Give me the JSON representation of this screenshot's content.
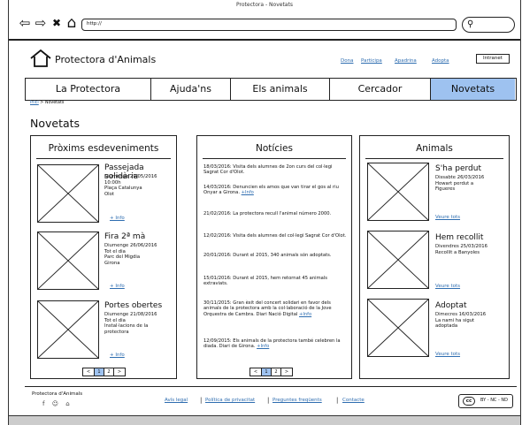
{
  "window": {
    "title": "Protectora - Novetats"
  },
  "browser": {
    "back_glyph": "⇦",
    "forward_glyph": "⇨",
    "close_glyph": "✖",
    "home_glyph": "⌂",
    "url": "http://",
    "search_glyph": "⚲"
  },
  "site": {
    "name": "Protectora d'Animals",
    "top_links": [
      "Dona",
      "Participa",
      "Apadrina",
      "Adopta"
    ],
    "intranet_label": "Intranet"
  },
  "nav": {
    "items": [
      "La Protectora",
      "Ajuda'ns",
      "Els animals",
      "Cercador",
      "Novetats"
    ],
    "active_index": 4,
    "active_color": "#9ec2f0"
  },
  "breadcrumb": {
    "home": "Inici",
    "separator": ">",
    "current": "Novetats"
  },
  "page": {
    "title": "Novetats"
  },
  "events": {
    "title": "Pròxims esdeveniments",
    "items": [
      {
        "title": "Passejada solidària",
        "details": "Diumenge 29/05/2016\n10:00h\nPlaça Catalunya\nOlot",
        "more": "+ Info"
      },
      {
        "title": "Fira 2ª mà",
        "details": "Diumenge 26/06/2016\nTot el dia\nParc del Migdia\nGirona",
        "more": "+ Info"
      },
      {
        "title": "Portes obertes",
        "details": "Diumenge 21/08/2016\nTot el dia\nInstal·lacions de la\nprotectora",
        "more": "+ Info"
      }
    ],
    "pager": [
      "<",
      "1",
      "2",
      ">"
    ]
  },
  "news": {
    "title": "Notícies",
    "items": [
      {
        "text": "18/03/2016: Visita dels alumnes de 2on curs del col·legi Sagrat Cor d'Olot.",
        "link": ""
      },
      {
        "text": "14/03/2016: Denuncien els amos que van tirar el gos al riu Onyar a Girona.",
        "link": "+Info"
      },
      {
        "text": "21/02/2016: La protectora recull l'animal número 2000.",
        "link": ""
      },
      {
        "text": "12/02/2016: Visita dels alumnes del col·legi Sagrat Cor d'Olot.",
        "link": ""
      },
      {
        "text": "20/01/2016: Durant el 2015, 340 animals són adoptats.",
        "link": ""
      },
      {
        "text": "15/01/2016: Durant el 2015, hem retornat 45 animals extraviats.",
        "link": ""
      },
      {
        "text": "30/11/2015: Gran èxit del concert solidari en favor dels animals de la protectora amb la col·laboració de la Jove Orquestra de Cambra. Diari Nació Digital",
        "link": "+Info"
      },
      {
        "text": "12/09/2015: Els animals de la protectora també celebren la diada. Diari de Girona.",
        "link": "+Info"
      }
    ],
    "pager": [
      "<",
      "1",
      "2",
      ">"
    ]
  },
  "animals": {
    "title": "Animals",
    "items": [
      {
        "title": "S'ha perdut",
        "details": "Dissabte 26/03/2016\nHowart perdut a\nFigueres",
        "more": "Veure tots"
      },
      {
        "title": "Hem recollit",
        "details": "Divendres 25/03/2016\nRecollit a Banyoles",
        "more": "Veure tots"
      },
      {
        "title": "Adoptat",
        "details": "Dimecres 16/03/2016\nLa nami ha sigut\nadoptada",
        "more": "Veure tots"
      }
    ]
  },
  "footer": {
    "name": "Protectora d'Animals",
    "social_glyphs": "f ☺ ⌂",
    "links": [
      "Avís legal",
      "Política de privacitat",
      "Preguntes freqüents",
      "Contacte"
    ],
    "separator": "|",
    "license_icon": "cc",
    "license": "BY - NC - ND"
  }
}
